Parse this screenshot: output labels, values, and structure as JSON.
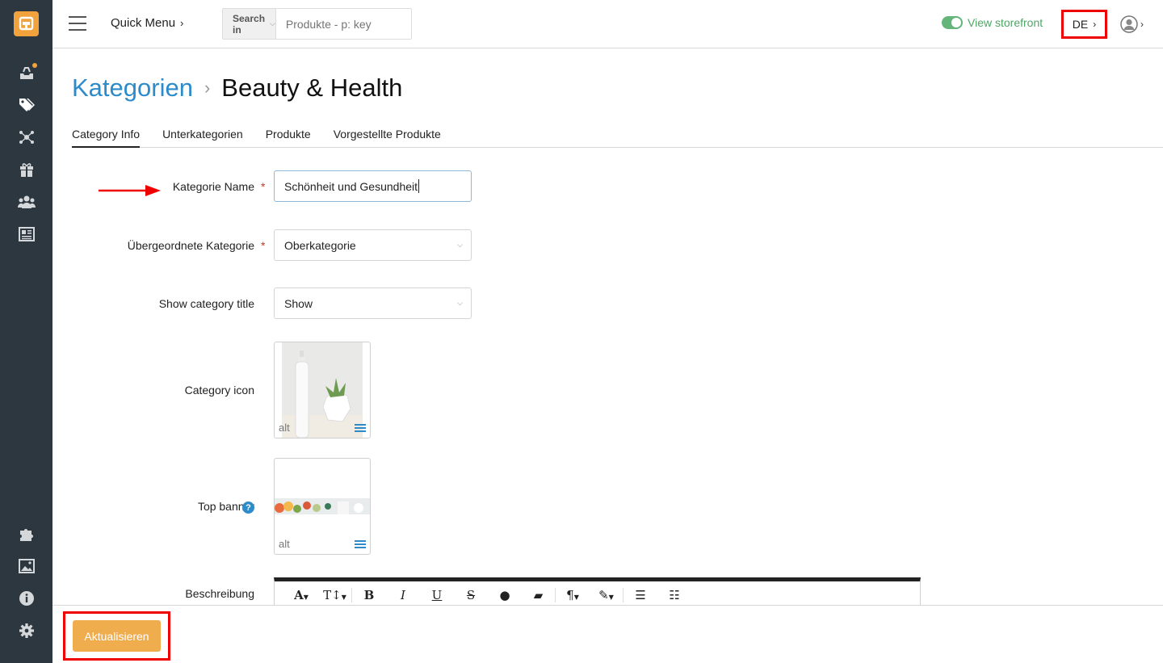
{
  "sidebar": {
    "logo": "shop-logo",
    "icons": [
      "orders-icon",
      "tags-icon",
      "network-icon",
      "gift-icon",
      "users-icon",
      "news-icon",
      "puzzle-icon",
      "image-icon",
      "info-icon",
      "settings-icon"
    ]
  },
  "topbar": {
    "quick_menu": "Quick Menu",
    "search_type": "Search in",
    "search_placeholder": "Produkte - p: key",
    "view_storefront": "View storefront",
    "language": "DE"
  },
  "breadcrumb": {
    "parent": "Kategorien",
    "current": "Beauty & Health"
  },
  "tabs": [
    "Category Info",
    "Unterkategorien",
    "Produkte",
    "Vorgestellte Produkte"
  ],
  "form": {
    "name_label": "Kategorie Name",
    "name_value": "Schönheit und Gesundheit",
    "parent_label": "Übergeordnete Kategorie",
    "parent_value": "Oberkategorie",
    "show_title_label": "Show category title",
    "show_title_value": "Show",
    "icon_label": "Category icon",
    "icon_alt": "alt",
    "banner_label": "Top banner",
    "banner_alt": "alt",
    "description_label": "Beschreibung",
    "required_mark": "*"
  },
  "editor_toolbar": [
    "A",
    "T↕",
    "B",
    "I",
    "U",
    "S",
    "💧",
    "eraser",
    "¶",
    "wand",
    "ol",
    "ul"
  ],
  "footer": {
    "save_label": "Aktualisieren"
  },
  "colors": {
    "sidebar_bg": "#2d3740",
    "accent_orange": "#f0ad4e",
    "link_blue": "#2e8bc9",
    "storefront_green": "#4ea665",
    "highlight_red": "#e00000"
  }
}
